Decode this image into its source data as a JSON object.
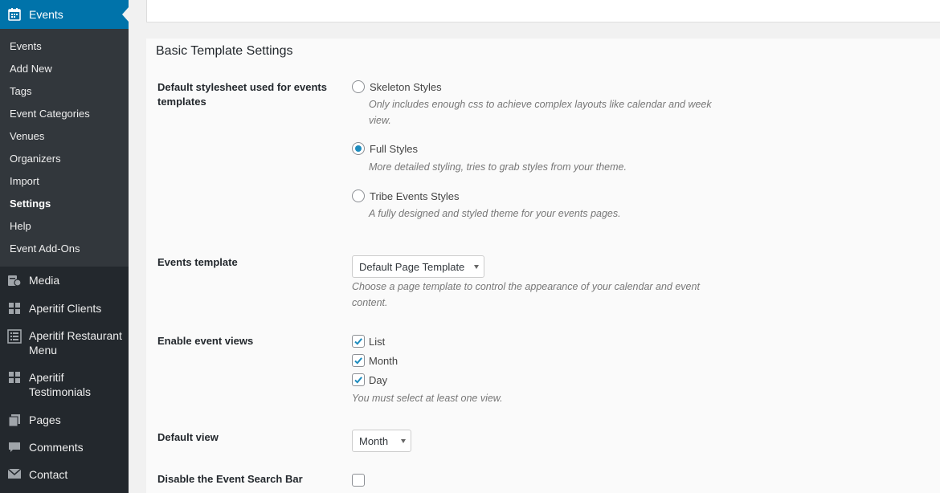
{
  "sidebar": {
    "active": {
      "label": "Events",
      "icon": "calendar-icon"
    },
    "submenu": [
      "Events",
      "Add New",
      "Tags",
      "Event Categories",
      "Venues",
      "Organizers",
      "Import",
      "Settings",
      "Help",
      "Event Add-Ons"
    ],
    "current": "Settings",
    "menu": [
      {
        "label": "Media",
        "icon": "media-icon"
      },
      {
        "label": "Aperitif Clients",
        "icon": "grid-icon"
      },
      {
        "label": "Aperitif Restaurant Menu",
        "icon": "list-icon"
      },
      {
        "label": "Aperitif Testimonials",
        "icon": "grid-icon"
      },
      {
        "label": "Pages",
        "icon": "pages-icon"
      },
      {
        "label": "Comments",
        "icon": "comments-icon"
      },
      {
        "label": "Contact",
        "icon": "mail-icon"
      }
    ]
  },
  "section": {
    "title": "Basic Template Settings"
  },
  "stylesheet": {
    "label": "Default stylesheet used for events templates",
    "options": [
      {
        "label": "Skeleton Styles",
        "desc": "Only includes enough css to achieve complex layouts like calendar and week view.",
        "checked": false
      },
      {
        "label": "Full Styles",
        "desc": "More detailed styling, tries to grab styles from your theme.",
        "checked": true
      },
      {
        "label": "Tribe Events Styles",
        "desc": "A fully designed and styled theme for your events pages.",
        "checked": false
      }
    ]
  },
  "events_template": {
    "label": "Events template",
    "value": "Default Page Template",
    "desc": "Choose a page template to control the appearance of your calendar and event content."
  },
  "event_views": {
    "label": "Enable event views",
    "options": [
      {
        "label": "List",
        "checked": true
      },
      {
        "label": "Month",
        "checked": true
      },
      {
        "label": "Day",
        "checked": true
      }
    ],
    "desc": "You must select at least one view."
  },
  "default_view": {
    "label": "Default view",
    "value": "Month"
  },
  "search_bar": {
    "label": "Disable the Event Search Bar",
    "checked": false
  },
  "colors": {
    "accent": "#0073aa",
    "sidebar": "#23282d",
    "submenu": "#32373c",
    "check": "#1e8cbe"
  }
}
